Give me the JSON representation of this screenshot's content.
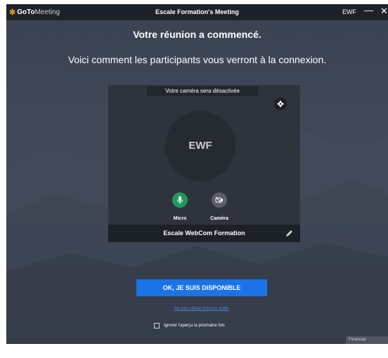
{
  "app": {
    "logo_brand": "GoTo",
    "logo_product": "Meeting",
    "window_title": "Escale Formation's Meeting",
    "user_initials": "EWF",
    "minimize_glyph": "—",
    "close_glyph": "✕"
  },
  "main": {
    "headline": "Votre réunion a commencé.",
    "subline": "Voici comment les participants vous verront à la connexion."
  },
  "preview": {
    "camera_notice": "Votre caméra sera désactivée",
    "avatar_initials": "EWF",
    "mic_label": "Micro",
    "camera_label": "Caméra",
    "display_name": "Escale WebCom Formation"
  },
  "actions": {
    "ok_button": "OK, JE SUIS DISPONIBLE",
    "other_link": "Ne pas utiliser d'autres audio",
    "skip_checkbox_label": "Ignorer l'aperçu la prochaine fois",
    "skip_checked": false
  },
  "footer": {
    "share_tag": "Financiar"
  },
  "icons": {
    "logo": "gotomeeting-logo-icon",
    "settings": "gear-icon",
    "mic": "microphone-icon",
    "camera": "camera-off-icon",
    "edit": "pencil-icon"
  },
  "colors": {
    "accent": "#1a73e8",
    "mic_on": "#1f9a5c",
    "titlebar": "#1d2129",
    "link": "#4a86e0"
  }
}
